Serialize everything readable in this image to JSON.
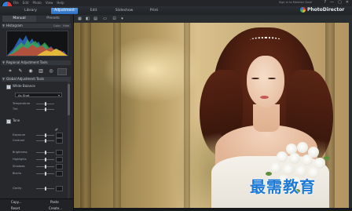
{
  "menu": [
    "File",
    "Edit",
    "Photo",
    "View",
    "Help"
  ],
  "signin": "Sign In to Member Zone",
  "window_controls": [
    "?",
    "—",
    "▢",
    "✕"
  ],
  "modes": [
    {
      "label": "Library",
      "active": false
    },
    {
      "label": "Adjustment",
      "active": true
    },
    {
      "label": "Edit",
      "active": false
    },
    {
      "label": "Slideshow",
      "active": false
    },
    {
      "label": "Print",
      "active": false
    }
  ],
  "brand": "PhotoDirector",
  "panel": {
    "sub_tabs": [
      {
        "label": "Manual",
        "active": true
      },
      {
        "label": "Presets",
        "active": false
      }
    ],
    "histogram": {
      "title": "Histogram",
      "extras": [
        "Color",
        "Hide"
      ]
    },
    "regional_tools": {
      "title": "Regional Adjustment Tools"
    },
    "global_tools": {
      "title": "Global Adjustment Tools"
    },
    "white_balance": {
      "title": "White Balance",
      "preset": "As Shot",
      "sliders": [
        "Temperature",
        "Tint"
      ]
    },
    "tone": {
      "title": "Tone",
      "sliders": [
        "Exposure",
        "Contrast",
        "Brightness",
        "Highlights",
        "Shadows",
        "Blacks",
        "Clarity"
      ]
    },
    "bottom": {
      "copy": "Copy...",
      "paste": "Paste",
      "reset": "Reset",
      "create": "Create..."
    }
  },
  "watermark": "最需教育",
  "icons": {
    "tool_row": [
      "crop-icon",
      "brush-icon",
      "eye-icon",
      "gradient-icon",
      "radial-icon"
    ],
    "view_tools": [
      "grid-icon",
      "compare-icon",
      "before-after-icon",
      "fullscreen-icon",
      "fit-icon",
      "zoom-icon"
    ]
  }
}
